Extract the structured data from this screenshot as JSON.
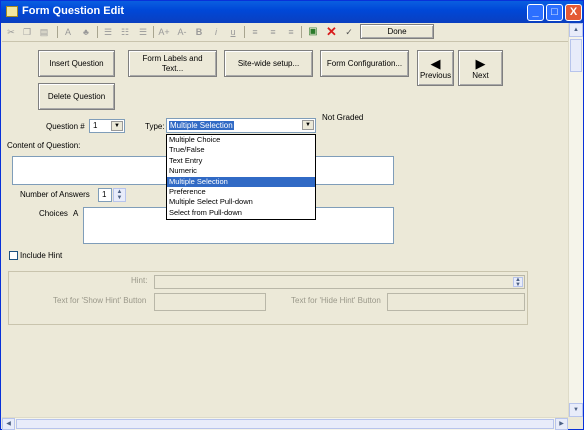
{
  "window": {
    "title": "Form Question Edit",
    "min_symbol": "_",
    "max_symbol": "□",
    "close_symbol": "X"
  },
  "toolbar": {
    "font_label": "A",
    "bold": "B",
    "italic": "i",
    "underline": "u",
    "font_grow": "A+",
    "font_shrink": "A-",
    "done_label": "Done"
  },
  "buttons": {
    "insert_question": "Insert Question",
    "form_labels": "Form Labels and Text...",
    "site_wide_setup": "Site-wide setup...",
    "form_configuration": "Form Configuration...",
    "previous": "Previous",
    "next": "Next",
    "delete_question": "Delete Question"
  },
  "question": {
    "number_label": "Question #",
    "number_value": "1",
    "type_label": "Type:",
    "type_value": "Multiple Selection",
    "graded_status": "Not Graded",
    "content_label": "Content of Question:",
    "content_value": "",
    "answers_label": "Number of Answers",
    "answers_value": "1",
    "choices_label": "Choices",
    "choice_letter": "A",
    "include_hint_label": "Include Hint"
  },
  "type_options": [
    "Multiple Choice",
    "True/False",
    "Text Entry",
    "Numeric",
    "Multiple Selection",
    "Preference",
    "Multiple Select Pull-down",
    "Select from Pull-down"
  ],
  "type_selected_index": 4,
  "hint": {
    "hint_label": "Hint:",
    "show_hint_label": "Text for 'Show Hint' Button",
    "hide_hint_label": "Text for 'Hide Hint' Button"
  },
  "colors": {
    "title_bar": "#0a5fe0",
    "selection": "#316ac5",
    "close_red": "#e45a35",
    "window_bg": "#ece9d8"
  }
}
